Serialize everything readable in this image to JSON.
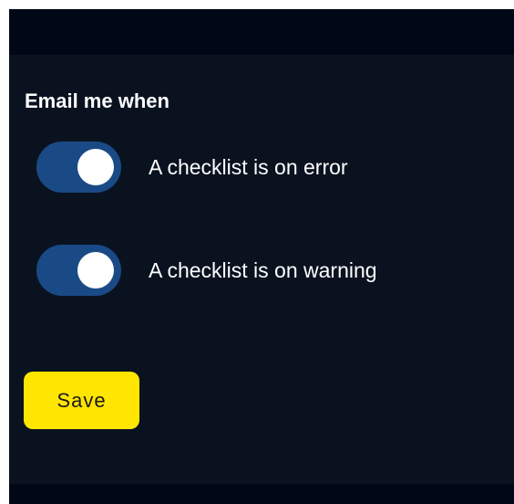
{
  "colors": {
    "outer_bar": "#000717",
    "panel_background": "#0a1220",
    "toggle_on_track": "#1a4a85",
    "toggle_knob": "#ffffff",
    "text": "#ffffff",
    "save_button_background": "#ffe600",
    "save_button_text": "#1a1a1a"
  },
  "settings": {
    "heading": "Email me when",
    "toggles": [
      {
        "label": "A checklist is on error",
        "checked": true
      },
      {
        "label": "A checklist is on warning",
        "checked": true
      }
    ],
    "save_label": "Save"
  }
}
